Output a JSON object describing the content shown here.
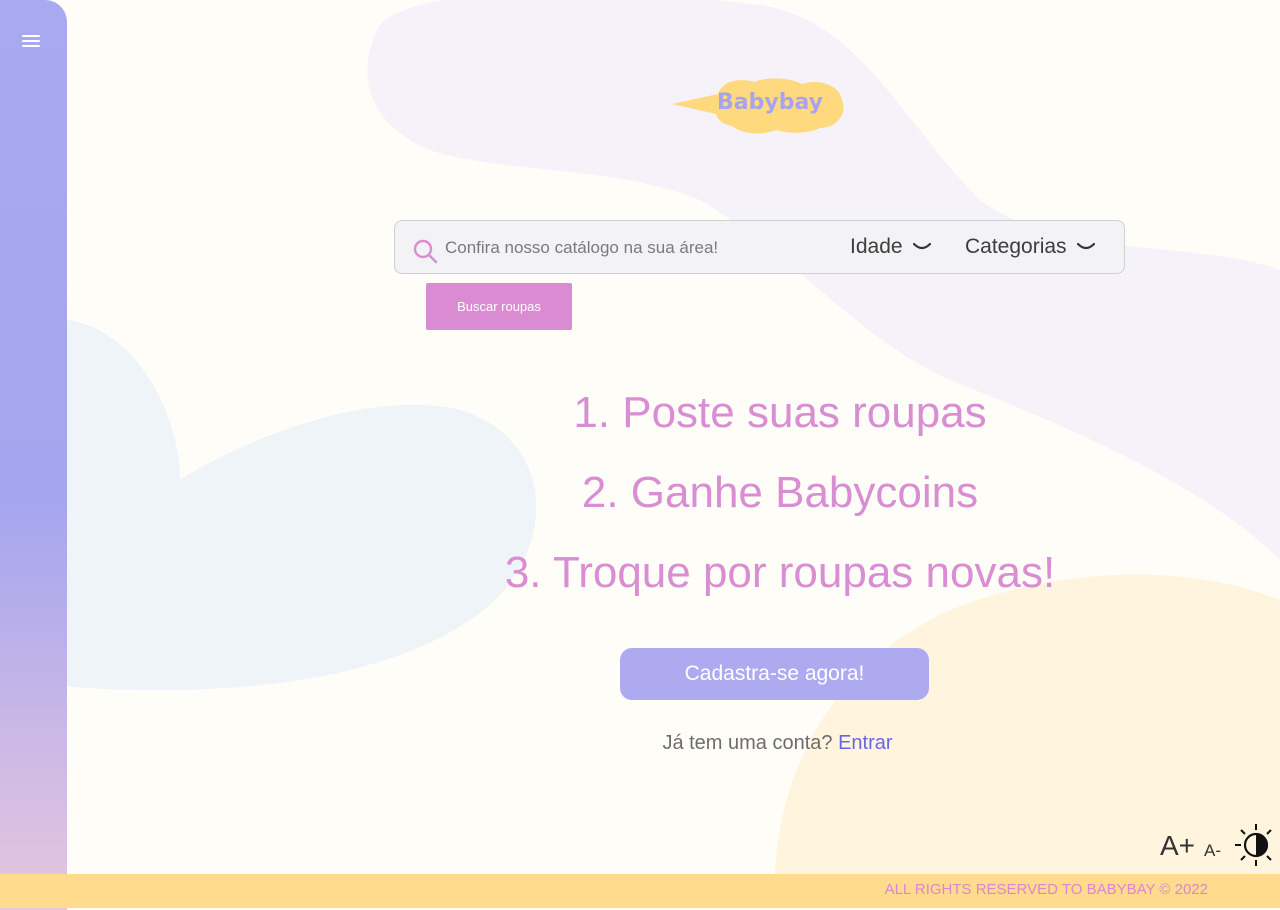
{
  "brand": {
    "logo_text": "Babybay",
    "logo_color": "#a8a3ee",
    "bubble_color": "#ffd97e"
  },
  "sidebar": {
    "menu_icon": "hamburger-menu-icon"
  },
  "search": {
    "placeholder": "Confira nosso catálogo na sua área!",
    "value": "",
    "age_label": "Idade",
    "categories_label": "Categorias",
    "submit_label": "Buscar roupas"
  },
  "steps": [
    "1. Poste suas roupas",
    "2. Ganhe Babycoins",
    "3. Troque por roupas novas!"
  ],
  "cta": {
    "signup_label": "Cadastra-se agora!"
  },
  "login": {
    "prompt": "Já tem uma conta? ",
    "link_label": "Entrar"
  },
  "accessibility": {
    "font_increase": "A+",
    "font_decrease": "A-",
    "contrast_icon": "contrast-toggle-icon"
  },
  "footer": {
    "text": "ALL RIGHTS RESERVED TO BABYBAY © 2022"
  },
  "colors": {
    "accent_pink": "#d98dd2",
    "accent_purple": "#aeaaef",
    "link": "#6b66e8",
    "footer_bg": "#ffdc8d"
  }
}
